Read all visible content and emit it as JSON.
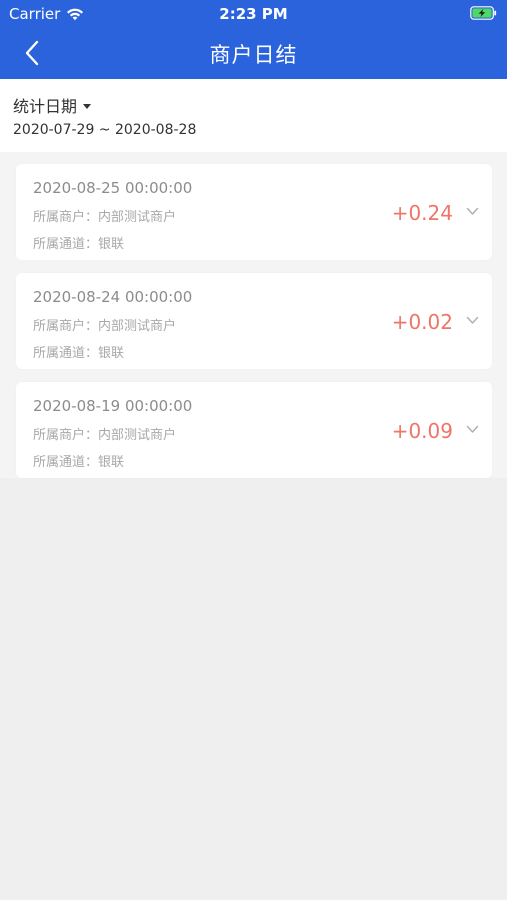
{
  "status_bar": {
    "carrier": "Carrier",
    "time": "2:23 PM",
    "wifi_icon": "wifi-icon",
    "battery_icon": "battery-charging-icon"
  },
  "nav": {
    "back_icon": "chevron-left-icon",
    "title": "商户日结"
  },
  "filter": {
    "label": "统计日期",
    "dropdown_icon": "caret-down-icon",
    "date_range": "2020-07-29 ~ 2020-08-28"
  },
  "records": [
    {
      "datetime": "2020-08-25 00:00:00",
      "merchant": "所属商户：内部测试商户",
      "channel": "所属通道：银联",
      "amount": "+0.24"
    },
    {
      "datetime": "2020-08-24 00:00:00",
      "merchant": "所属商户：内部测试商户",
      "channel": "所属通道：银联",
      "amount": "+0.02"
    },
    {
      "datetime": "2020-08-19 00:00:00",
      "merchant": "所属商户：内部测试商户",
      "channel": "所属通道：银联",
      "amount": "+0.09"
    }
  ],
  "colors": {
    "header": "#2b63dc",
    "amount": "#f07467",
    "background": "#efefef"
  }
}
